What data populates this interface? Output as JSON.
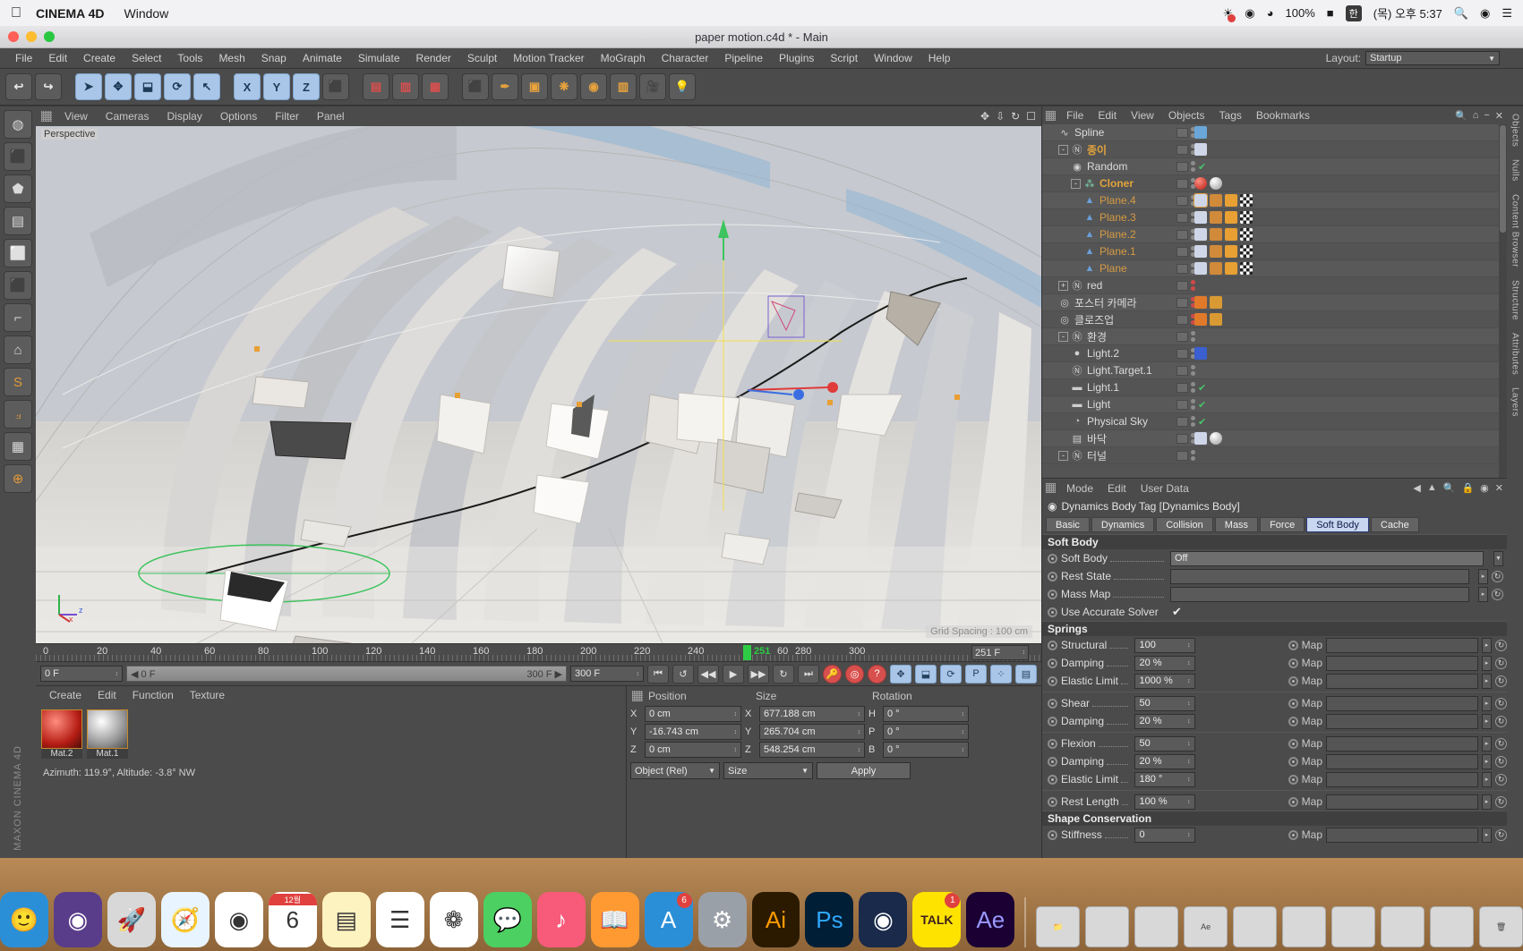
{
  "macbar": {
    "apple_icon": "apple-icon",
    "app_name": "CINEMA 4D",
    "window_menu": "Window",
    "talk_icon": "kakaotalk-icon",
    "cc_icon": "creative-cloud-icon",
    "wifi_icon": "wifi-icon",
    "battery_pct": "100%",
    "battery_icon": "battery-charging-icon",
    "input_source": "한",
    "clock": "(목) 오후 5:37",
    "search_icon": "spotlight-icon",
    "siri_icon": "siri-icon",
    "controlcenter_icon": "list-icon"
  },
  "window": {
    "title": "paper motion.c4d * - Main"
  },
  "main_menu": [
    "File",
    "Edit",
    "Create",
    "Select",
    "Tools",
    "Mesh",
    "Snap",
    "Animate",
    "Simulate",
    "Render",
    "Sculpt",
    "Motion Tracker",
    "MoGraph",
    "Character",
    "Pipeline",
    "Plugins",
    "Script",
    "Window",
    "Help"
  ],
  "layout": {
    "label": "Layout:",
    "value": "Startup"
  },
  "toolbar": {
    "buttons": [
      {
        "name": "undo-button",
        "glyph": "↩"
      },
      {
        "name": "redo-button",
        "glyph": "↪"
      },
      {
        "name": "select-tool",
        "glyph": "➤"
      },
      {
        "name": "move-tool",
        "glyph": "✥"
      },
      {
        "name": "scale-tool",
        "glyph": "⬓"
      },
      {
        "name": "rotate-tool",
        "glyph": "⟳"
      },
      {
        "name": "cursor-tool",
        "glyph": "↖"
      },
      {
        "name": "axis-x-button",
        "glyph": "X"
      },
      {
        "name": "axis-y-button",
        "glyph": "Y"
      },
      {
        "name": "axis-z-button",
        "glyph": "Z"
      },
      {
        "name": "world-axis-button",
        "glyph": "⬛"
      },
      {
        "name": "render-view-button",
        "glyph": "▤"
      },
      {
        "name": "render-region-button",
        "glyph": "▥"
      },
      {
        "name": "render-settings-button",
        "glyph": "▦"
      },
      {
        "name": "cube-primitive-button",
        "glyph": "⬛"
      },
      {
        "name": "spline-pen-button",
        "glyph": "✒"
      },
      {
        "name": "nurbs-button",
        "glyph": "▣"
      },
      {
        "name": "array-button",
        "glyph": "❋"
      },
      {
        "name": "deformer-button",
        "glyph": "◉"
      },
      {
        "name": "environment-button",
        "glyph": "▥"
      },
      {
        "name": "camera-button",
        "glyph": "🎥"
      },
      {
        "name": "light-button",
        "glyph": "💡"
      }
    ]
  },
  "left_toolbar": [
    {
      "name": "live-selection-tool",
      "glyph": "◍"
    },
    {
      "name": "box-object-tool",
      "glyph": "⬛"
    },
    {
      "name": "point-mode-tool",
      "glyph": "⬟"
    },
    {
      "name": "edge-mode-tool",
      "glyph": "▤"
    },
    {
      "name": "polygon-mode-tool",
      "glyph": "⬜"
    },
    {
      "name": "model-mode-tool",
      "glyph": "⬛"
    },
    {
      "name": "texture-mode-tool",
      "glyph": "⌐"
    },
    {
      "name": "workplane-tool",
      "glyph": "⌂"
    },
    {
      "name": "snap-tool",
      "glyph": "S"
    },
    {
      "name": "lock-axis-tool",
      "glyph": "⟓"
    },
    {
      "name": "viewport-solo-tool",
      "glyph": "▦"
    },
    {
      "name": "enable-axis-tool",
      "glyph": "⊕"
    }
  ],
  "brand": "MAXON CINEMA 4D",
  "viewport": {
    "menu": [
      "View",
      "Cameras",
      "Display",
      "Options",
      "Filter",
      "Panel"
    ],
    "perspective_label": "Perspective",
    "grid_info": "Grid Spacing : 100 cm",
    "nav_icons": [
      "pan-icon",
      "zoom-icon",
      "rotate-icon",
      "maximize-icon"
    ]
  },
  "timeline": {
    "ticks": [
      "0",
      "20",
      "40",
      "60",
      "80",
      "100",
      "120",
      "140",
      "160",
      "180",
      "200",
      "220",
      "240",
      "280",
      "300"
    ],
    "playhead_label": "251",
    "playhead_secondary": "60",
    "end_frame_field": "251 F",
    "current_frame": "0 F",
    "range_start": "0 F",
    "range_end": "300 F",
    "max_frame": "300 F",
    "transport": [
      {
        "name": "go-to-start-button",
        "glyph": "⏮"
      },
      {
        "name": "play-backwards-button",
        "glyph": "↺"
      },
      {
        "name": "step-back-button",
        "glyph": "◀◀"
      },
      {
        "name": "play-button",
        "glyph": "▶"
      },
      {
        "name": "step-forward-button",
        "glyph": "▶▶"
      },
      {
        "name": "loop-button",
        "glyph": "↻"
      },
      {
        "name": "go-to-end-button",
        "glyph": "⏭"
      },
      {
        "name": "record-keyframe-button",
        "glyph": "🔑"
      },
      {
        "name": "autokey-button",
        "glyph": "◎"
      },
      {
        "name": "keyframe-selection-button",
        "glyph": "?"
      },
      {
        "name": "position-key-button",
        "glyph": "✥"
      },
      {
        "name": "scale-key-button",
        "glyph": "⬓"
      },
      {
        "name": "rotation-key-button",
        "glyph": "⟳"
      },
      {
        "name": "param-key-button",
        "glyph": "P"
      },
      {
        "name": "point-level-anim-button",
        "glyph": "⁘"
      },
      {
        "name": "timeline-button",
        "glyph": "▤"
      }
    ]
  },
  "material_manager": {
    "menu": [
      "Create",
      "Edit",
      "Function",
      "Texture"
    ],
    "materials": [
      {
        "name": "Mat.2",
        "color": "red"
      },
      {
        "name": "Mat.1",
        "color": "white"
      }
    ],
    "status": "Azimuth: 119.9°, Altitude: -3.8°  NW"
  },
  "coordinates": {
    "columns": [
      "Position",
      "Size",
      "Rotation"
    ],
    "rows": [
      {
        "axis": "X",
        "position": "0 cm",
        "size": "677.188 cm",
        "rot_axis": "H",
        "rotation": "0 °"
      },
      {
        "axis": "Y",
        "position": "-16.743 cm",
        "size": "265.704 cm",
        "rot_axis": "P",
        "rotation": "0 °"
      },
      {
        "axis": "Z",
        "position": "0 cm",
        "size": "548.254 cm",
        "rot_axis": "B",
        "rotation": "0 °"
      }
    ],
    "mode_select": "Object (Rel)",
    "size_select": "Size",
    "apply_button": "Apply"
  },
  "object_manager": {
    "menu": [
      "File",
      "Edit",
      "View",
      "Objects",
      "Tags",
      "Bookmarks"
    ],
    "right_icons": [
      "search-icon",
      "home-icon",
      "minimize-icon",
      "close-icon"
    ],
    "items": [
      {
        "label": "Spline",
        "depth": 1,
        "icon": "spline-icon",
        "color": "normal",
        "check": true,
        "expand": null,
        "tags": [
          "spline-tag"
        ]
      },
      {
        "label": "종이",
        "depth": 1,
        "icon": "null-icon",
        "color": "orange",
        "check": false,
        "expand": "-",
        "tags": [
          "dynamics-tag"
        ]
      },
      {
        "label": "Random",
        "depth": 2,
        "icon": "effector-icon",
        "color": "normal",
        "check": true,
        "expand": null,
        "tags": []
      },
      {
        "label": "Cloner",
        "depth": 2,
        "icon": "cloner-icon",
        "color": "orange",
        "check": true,
        "expand": "-",
        "tags": [
          "red-material-tag",
          "white-material-tag"
        ]
      },
      {
        "label": "Plane.4",
        "depth": 3,
        "icon": "plane-icon",
        "color": "orange2",
        "check": false,
        "expand": null,
        "tags": [
          "dynamics-tag-selected",
          "phong-tag",
          "vertex-tag",
          "checker-tag"
        ]
      },
      {
        "label": "Plane.3",
        "depth": 3,
        "icon": "plane-icon",
        "color": "orange2",
        "check": false,
        "expand": null,
        "tags": [
          "dynamics-tag",
          "phong-tag",
          "vertex-tag",
          "checker-tag"
        ]
      },
      {
        "label": "Plane.2",
        "depth": 3,
        "icon": "plane-icon",
        "color": "orange2",
        "check": false,
        "expand": null,
        "tags": [
          "dynamics-tag",
          "phong-tag",
          "vertex-tag",
          "checker-tag"
        ]
      },
      {
        "label": "Plane.1",
        "depth": 3,
        "icon": "plane-icon",
        "color": "orange2",
        "check": false,
        "expand": null,
        "tags": [
          "dynamics-tag",
          "phong-tag",
          "vertex-tag",
          "checker-tag"
        ]
      },
      {
        "label": "Plane",
        "depth": 3,
        "icon": "plane-icon",
        "color": "orange2",
        "check": false,
        "expand": null,
        "tags": [
          "dynamics-tag",
          "phong-tag",
          "vertex-tag",
          "checker-tag"
        ]
      },
      {
        "label": "red",
        "depth": 1,
        "icon": "null-icon",
        "color": "normal",
        "check": false,
        "expand": "+",
        "tags": []
      },
      {
        "label": "포스터 카메라",
        "depth": 1,
        "icon": "camera-icon",
        "color": "normal",
        "check": false,
        "expand": null,
        "tags": [
          "no-entry-tag",
          "film-tag"
        ]
      },
      {
        "label": "클로즈업",
        "depth": 1,
        "icon": "camera-icon",
        "color": "normal",
        "check": false,
        "expand": null,
        "tags": [
          "no-entry-tag",
          "film-tag"
        ]
      },
      {
        "label": "환경",
        "depth": 1,
        "icon": "null-icon",
        "color": "normal",
        "check": false,
        "expand": "-",
        "tags": []
      },
      {
        "label": "Light.2",
        "depth": 2,
        "icon": "light-icon",
        "color": "normal",
        "check": true,
        "expand": null,
        "tags": [
          "target-tag"
        ]
      },
      {
        "label": "Light.Target.1",
        "depth": 2,
        "icon": "null-icon",
        "color": "normal",
        "check": false,
        "expand": null,
        "tags": []
      },
      {
        "label": "Light.1",
        "depth": 2,
        "icon": "arealight-icon",
        "color": "normal",
        "check": true,
        "expand": null,
        "tags": []
      },
      {
        "label": "Light",
        "depth": 2,
        "icon": "arealight-icon",
        "color": "normal",
        "check": true,
        "expand": null,
        "tags": []
      },
      {
        "label": "Physical Sky",
        "depth": 2,
        "icon": "sky-icon",
        "color": "normal",
        "check": true,
        "expand": null,
        "tags": []
      },
      {
        "label": "바닥",
        "depth": 2,
        "icon": "floor-icon",
        "color": "normal",
        "check": false,
        "expand": null,
        "tags": [
          "dynamics-tag",
          "white-material-tag"
        ]
      },
      {
        "label": "터널",
        "depth": 1,
        "icon": "null-icon",
        "color": "normal",
        "check": false,
        "expand": "-",
        "tags": []
      }
    ]
  },
  "attributes": {
    "menu": [
      "Mode",
      "Edit",
      "User Data"
    ],
    "right_icons": [
      "back-arrow-icon",
      "up-arrow-icon",
      "search-icon",
      "lock-icon",
      "pin-icon",
      "close-icon"
    ],
    "title": "Dynamics Body Tag [Dynamics Body]",
    "tabs": [
      "Basic",
      "Dynamics",
      "Collision",
      "Mass",
      "Force",
      "Soft Body",
      "Cache"
    ],
    "active_tab": "Soft Body",
    "sections": [
      {
        "header": "Soft Body",
        "rows": [
          {
            "label": "Soft Body",
            "value": "Off",
            "type": "dropdown",
            "map": false
          },
          {
            "label": "Rest State",
            "value": "",
            "type": "link",
            "map": false
          },
          {
            "label": "Mass Map",
            "value": "",
            "type": "link",
            "map": false
          },
          {
            "label": "Use Accurate Solver",
            "value": "✔",
            "type": "checkbox",
            "map": false
          }
        ]
      },
      {
        "header": "Springs",
        "rows": [
          {
            "label": "Structural",
            "value": "100",
            "type": "number",
            "map": true,
            "map_label": "Map"
          },
          {
            "label": "Damping",
            "value": "20 %",
            "type": "number",
            "map": true,
            "map_label": "Map"
          },
          {
            "label": "Elastic Limit",
            "value": "1000 %",
            "type": "number",
            "map": true,
            "map_label": "Map"
          },
          {
            "label": "Shear",
            "value": "50",
            "type": "number",
            "map": true,
            "map_label": "Map",
            "divider": true
          },
          {
            "label": "Damping",
            "value": "20 %",
            "type": "number",
            "map": true,
            "map_label": "Map"
          },
          {
            "label": "Flexion",
            "value": "50",
            "type": "number",
            "map": true,
            "map_label": "Map",
            "divider": true
          },
          {
            "label": "Damping",
            "value": "20 %",
            "type": "number",
            "map": true,
            "map_label": "Map"
          },
          {
            "label": "Elastic Limit",
            "value": "180 °",
            "type": "number",
            "map": true,
            "map_label": "Map"
          },
          {
            "label": "Rest Length",
            "value": "100 %",
            "type": "number",
            "map": true,
            "map_label": "Map",
            "divider": true
          }
        ]
      },
      {
        "header": "Shape Conservation",
        "rows": [
          {
            "label": "Stiffness",
            "value": "0",
            "type": "number",
            "map": true,
            "map_label": "Map"
          }
        ]
      }
    ]
  },
  "right_strip": [
    "Objects",
    "Nulls",
    "Content Browser",
    "Structure",
    "Attributes",
    "Layers"
  ],
  "dock": {
    "icons": [
      {
        "name": "finder-icon",
        "glyph": "🙂",
        "bg": "#2b8fd8"
      },
      {
        "name": "siri-icon",
        "glyph": "◉",
        "bg": "#5a3d8a"
      },
      {
        "name": "launchpad-icon",
        "glyph": "🚀",
        "bg": "#d8d8d8"
      },
      {
        "name": "safari-icon",
        "glyph": "🧭",
        "bg": "#e8f4ff"
      },
      {
        "name": "chrome-icon",
        "glyph": "◉",
        "bg": "#ffffff"
      },
      {
        "name": "calendar-icon",
        "glyph": "6",
        "bg": "#ffffff",
        "badge": "12월"
      },
      {
        "name": "notes-icon",
        "glyph": "▤",
        "bg": "#fdf3c0"
      },
      {
        "name": "reminders-icon",
        "glyph": "☰",
        "bg": "#ffffff"
      },
      {
        "name": "photos-icon",
        "glyph": "❁",
        "bg": "#ffffff"
      },
      {
        "name": "messages-icon",
        "glyph": "💬",
        "bg": "#4cd061"
      },
      {
        "name": "music-icon",
        "glyph": "♪",
        "bg": "#f85a7a"
      },
      {
        "name": "books-icon",
        "glyph": "📖",
        "bg": "#ff9a33"
      },
      {
        "name": "appstore-icon",
        "glyph": "A",
        "bg": "#2b8fd8",
        "badge": "6"
      },
      {
        "name": "settings-icon",
        "glyph": "⚙",
        "bg": "#9aa0a8"
      },
      {
        "name": "illustrator-icon",
        "glyph": "Ai",
        "bg": "#2b1a00"
      },
      {
        "name": "photoshop-icon",
        "glyph": "Ps",
        "bg": "#001e36"
      },
      {
        "name": "cinema4d-icon",
        "glyph": "◉",
        "bg": "#1a2a4a"
      },
      {
        "name": "kakaotalk-icon",
        "glyph": "TALK",
        "bg": "#ffe300",
        "badge": "1"
      },
      {
        "name": "aftereffects-icon",
        "glyph": "Ae",
        "bg": "#1a0033"
      }
    ],
    "minimized": [
      {
        "name": "folder-icon",
        "glyph": "📁"
      },
      {
        "name": "window-thumb-1",
        "glyph": ""
      },
      {
        "name": "window-thumb-2",
        "glyph": ""
      },
      {
        "name": "window-thumb-3",
        "glyph": "Ae"
      },
      {
        "name": "window-thumb-4",
        "glyph": ""
      },
      {
        "name": "window-thumb-5",
        "glyph": ""
      },
      {
        "name": "window-thumb-6",
        "glyph": ""
      },
      {
        "name": "window-thumb-7",
        "glyph": ""
      },
      {
        "name": "window-thumb-8",
        "glyph": ""
      },
      {
        "name": "trash-icon",
        "glyph": "🗑"
      }
    ]
  }
}
